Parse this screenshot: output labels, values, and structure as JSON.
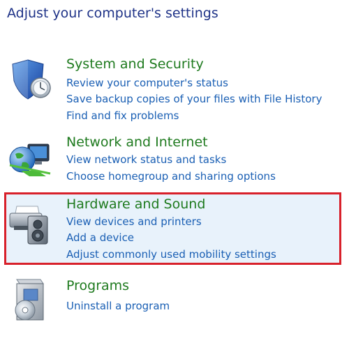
{
  "page": {
    "title": "Adjust your computer's settings"
  },
  "categories": [
    {
      "title": "System and Security",
      "icon": "shield-icon",
      "links": [
        "Review your computer's status",
        "Save backup copies of your files with File History",
        "Find and fix problems"
      ]
    },
    {
      "title": "Network and Internet",
      "icon": "globe-network-icon",
      "links": [
        "View network status and tasks",
        "Choose homegroup and sharing options"
      ]
    },
    {
      "title": "Hardware and Sound",
      "icon": "printer-speaker-icon",
      "highlighted": true,
      "links": [
        "View devices and printers",
        "Add a device",
        "Adjust commonly used mobility settings"
      ]
    },
    {
      "title": "Programs",
      "icon": "programs-disc-icon",
      "links": [
        "Uninstall a program"
      ]
    }
  ],
  "colors": {
    "title": "#1e3287",
    "category_title": "#1e7a1e",
    "link": "#1a5fb4",
    "highlight_border": "#d8202a",
    "highlight_fill": "#e8f2fb"
  }
}
